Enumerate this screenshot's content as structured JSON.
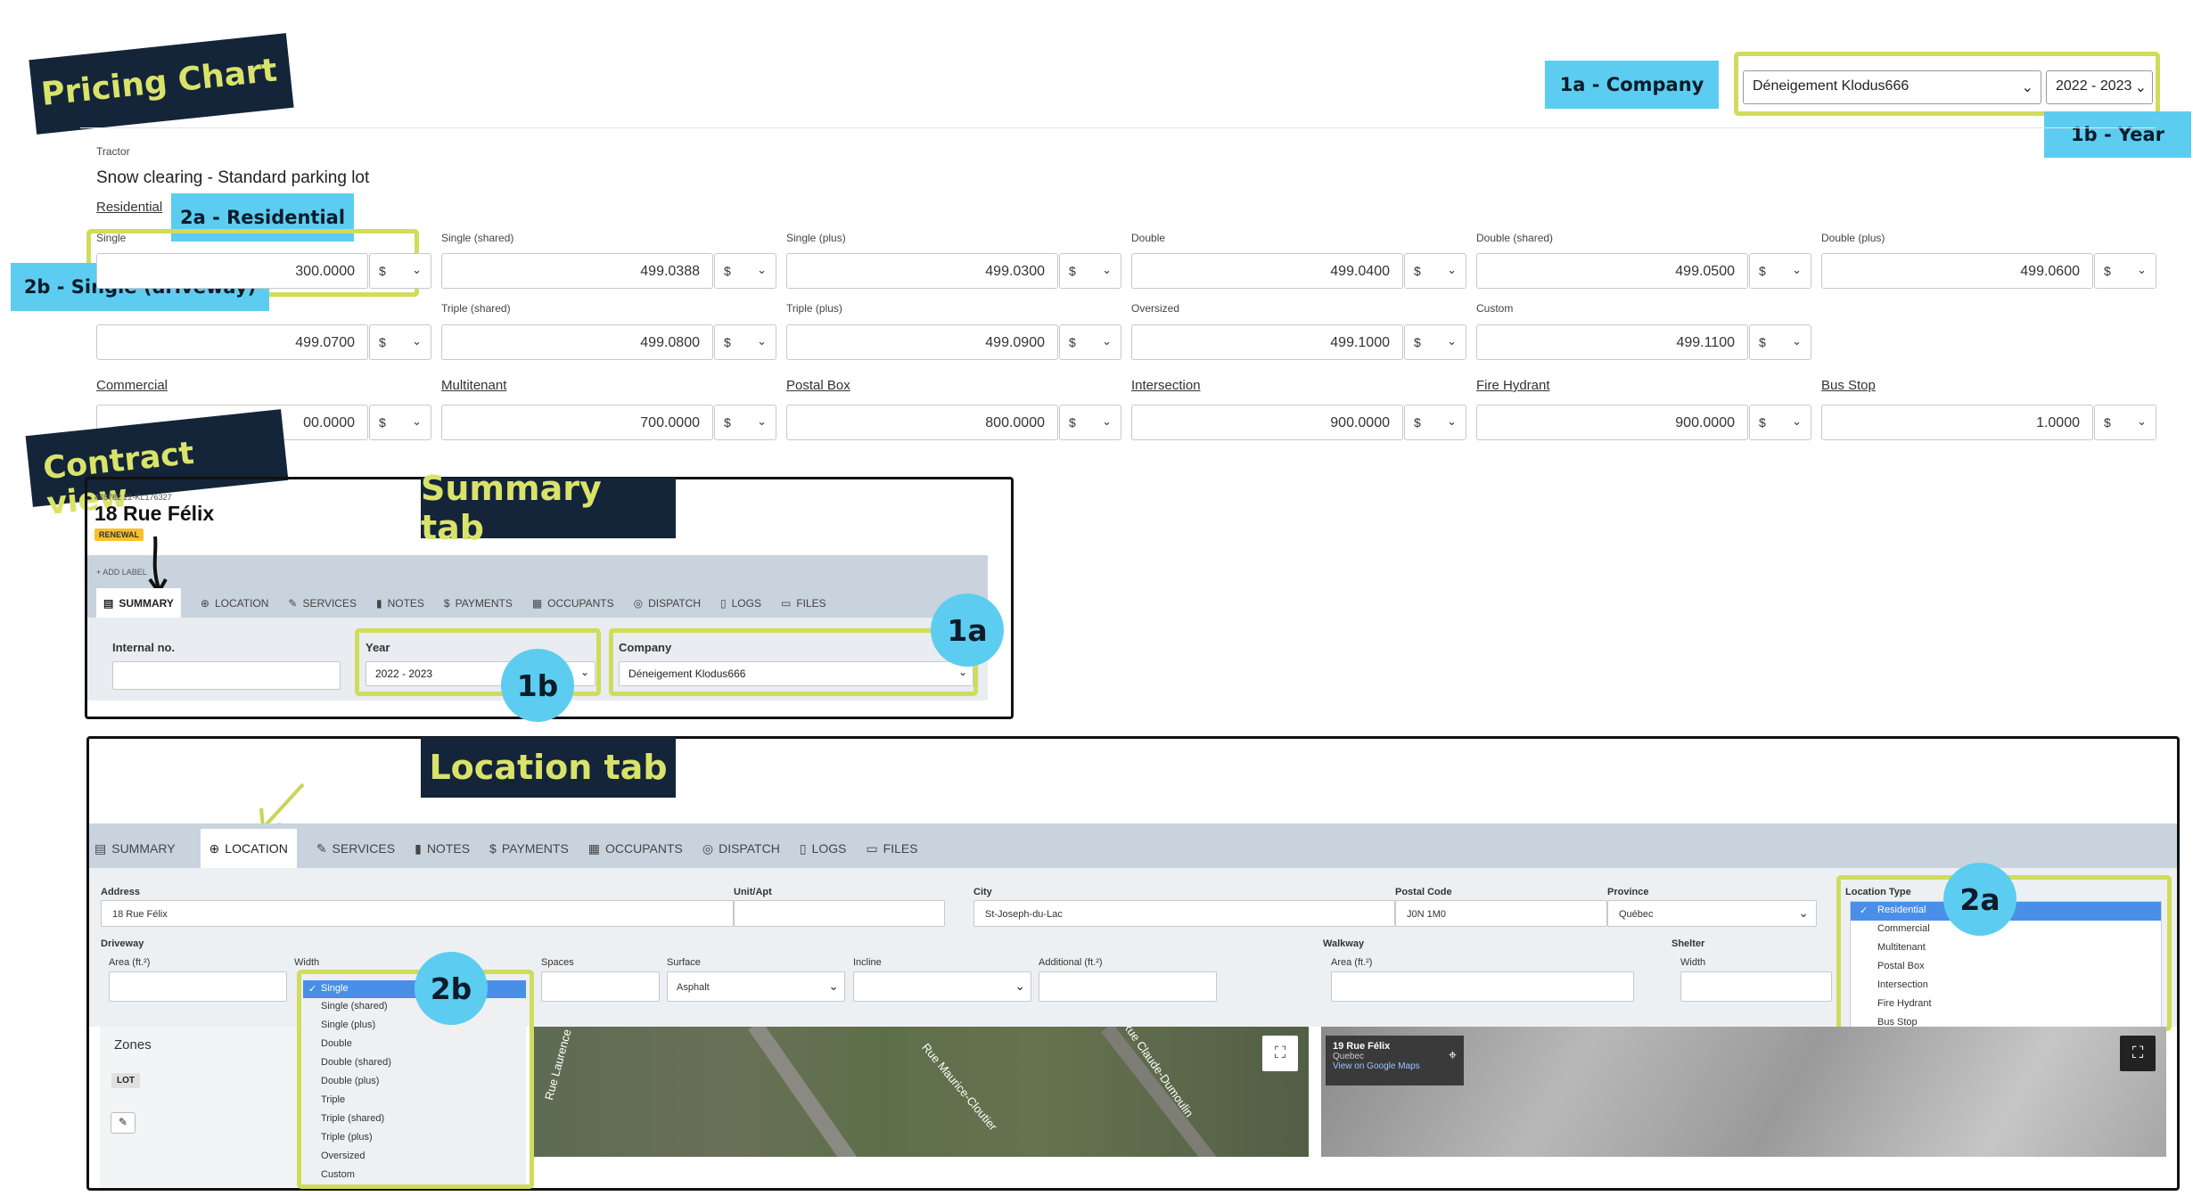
{
  "tags": {
    "pricing_chart": "Pricing Chart",
    "contract_view": "Contract view",
    "summary_tab": "Summary tab",
    "location_tab": "Location tab",
    "company": "1a - Company",
    "year": "1b - Year",
    "residential": "2a - Residential",
    "single_driveway": "2b - Single (driveway)",
    "c1a": "1a",
    "c1b": "1b",
    "c2a": "2a",
    "c2b": "2b"
  },
  "pricing": {
    "company_value": "Déneigement Klodus666",
    "year_value": "2022 - 2023",
    "category": "Tractor",
    "service": "Snow clearing - Standard parking lot",
    "residential_link": "Residential",
    "currency": "$",
    "row1": [
      {
        "label": "Single",
        "value": "300.0000"
      },
      {
        "label": "Single (shared)",
        "value": "499.0388"
      },
      {
        "label": "Single (plus)",
        "value": "499.0300"
      },
      {
        "label": "Double",
        "value": "499.0400"
      },
      {
        "label": "Double (shared)",
        "value": "499.0500"
      },
      {
        "label": "Double (plus)",
        "value": "499.0600"
      }
    ],
    "row2": [
      {
        "label": "",
        "value": "499.0700"
      },
      {
        "label": "Triple (shared)",
        "value": "499.0800"
      },
      {
        "label": "Triple (plus)",
        "value": "499.0900"
      },
      {
        "label": "Oversized",
        "value": "499.1000"
      },
      {
        "label": "Custom",
        "value": "499.1100"
      }
    ],
    "row3": [
      {
        "label": "Commercial",
        "value": "00.0000"
      },
      {
        "label": "Multitenant",
        "value": "700.0000"
      },
      {
        "label": "Postal Box",
        "value": "800.0000"
      },
      {
        "label": "Intersection",
        "value": "900.0000"
      },
      {
        "label": "Fire Hydrant",
        "value": "900.0000"
      },
      {
        "label": "Bus Stop",
        "value": "1.0000"
      }
    ]
  },
  "summary": {
    "ids": "488782   22-KL176327",
    "title": "18 Rue Félix",
    "badge": "RENEWAL",
    "add_label": "+ ADD LABEL",
    "tabs": [
      "SUMMARY",
      "LOCATION",
      "SERVICES",
      "NOTES",
      "PAYMENTS",
      "OCCUPANTS",
      "DISPATCH",
      "LOGS",
      "FILES"
    ],
    "internal_label": "Internal no.",
    "internal_value": "",
    "year_label": "Year",
    "year_value": "2022 - 2023",
    "company_label": "Company",
    "company_value": "Déneigement Klodus666"
  },
  "location": {
    "tabs": [
      "SUMMARY",
      "LOCATION",
      "SERVICES",
      "NOTES",
      "PAYMENTS",
      "OCCUPANTS",
      "DISPATCH",
      "LOGS",
      "FILES"
    ],
    "address_label": "Address",
    "address_value": "18 Rue Félix",
    "unit_label": "Unit/Apt",
    "unit_value": "",
    "city_label": "City",
    "city_value": "St-Joseph-du-Lac",
    "postal_label": "Postal Code",
    "postal_value": "J0N 1M0",
    "province_label": "Province",
    "province_value": "Québec",
    "location_type_label": "Location Type",
    "location_types": [
      "Residential",
      "Commercial",
      "Multitenant",
      "Postal Box",
      "Intersection",
      "Fire Hydrant",
      "Bus Stop"
    ],
    "driveway_label": "Driveway",
    "area_label": "Area (ft.²)",
    "width_label": "Width",
    "widths": [
      "Single",
      "Single (shared)",
      "Single (plus)",
      "Double",
      "Double (shared)",
      "Double (plus)",
      "Triple",
      "Triple (shared)",
      "Triple (plus)",
      "Oversized",
      "Custom"
    ],
    "spaces_label": "Spaces",
    "surface_label": "Surface",
    "surface_value": "Asphalt",
    "incline_label": "Incline",
    "additional_label": "Additional (ft.²)",
    "walkway_label": "Walkway",
    "walk_area_label": "Area (ft.²)",
    "shelter_label": "Shelter",
    "shelter_width_label": "Width",
    "zones_label": "Zones",
    "lot_badge": "LOT",
    "map_streets": [
      "Rue Maurice-Cloutier",
      "Rue Claude-Dumoulin",
      "Rue Laurence"
    ],
    "gm_title": "19 Rue Félix",
    "gm_sub": "Quebec",
    "gm_link": "View on Google Maps"
  },
  "colors": {
    "navy": "#14253a",
    "yellow": "#d9e36a",
    "cyan": "#5ccdf0",
    "frame": "#d0dc5a",
    "tabbar": "#c8d3de",
    "select": "#4a8fe7"
  }
}
